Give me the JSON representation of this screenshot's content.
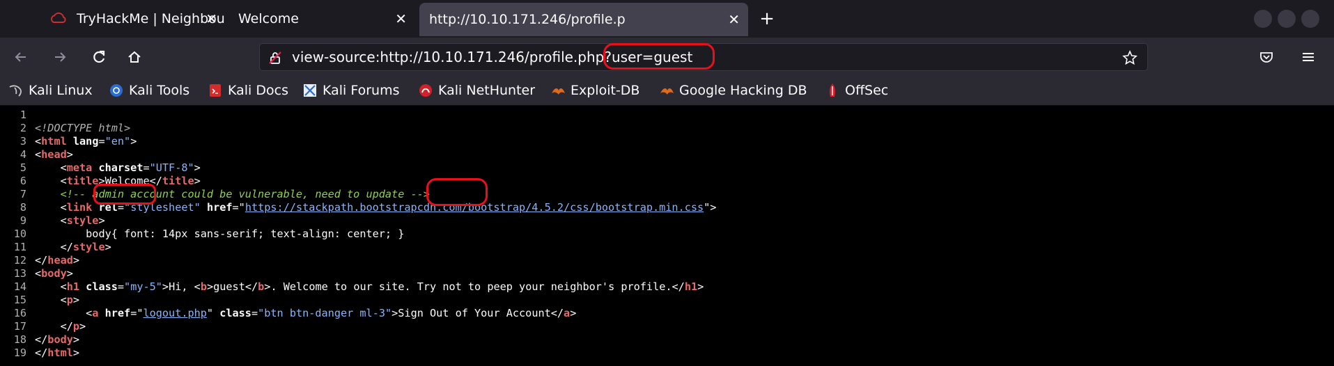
{
  "tabs": [
    {
      "label": "TryHackMe | Neighbour",
      "icon": "tryhackme-icon",
      "active": false
    },
    {
      "label": "Welcome",
      "icon": "",
      "active": false
    },
    {
      "label": "http://10.10.171.246/profile.p",
      "icon": "",
      "active": true
    }
  ],
  "nav": {
    "url_prefix": "view-source:http://10.10.171.246/profile.php",
    "url_query": "?user=guest"
  },
  "bookmarks": [
    {
      "label": "Kali Linux",
      "icon": "kali-dragon-icon"
    },
    {
      "label": "Kali Tools",
      "icon": "kali-tools-icon"
    },
    {
      "label": "Kali Docs",
      "icon": "kali-docs-icon"
    },
    {
      "label": "Kali Forums",
      "icon": "kali-forums-icon"
    },
    {
      "label": "Kali NetHunter",
      "icon": "nethunter-icon"
    },
    {
      "label": "Exploit-DB",
      "icon": "exploit-db-icon"
    },
    {
      "label": "Google Hacking DB",
      "icon": "ghdb-icon"
    },
    {
      "label": "OffSec",
      "icon": "offsec-icon"
    }
  ],
  "source": {
    "line_numbers": [
      "1",
      "2",
      "3",
      "4",
      "5",
      "6",
      "7",
      "8",
      "9",
      "10",
      "11",
      "12",
      "13",
      "14",
      "15",
      "16",
      "17",
      "18",
      "19"
    ],
    "doctype": "<!DOCTYPE html>",
    "html_tag": "html",
    "lang_attr": "lang",
    "lang_val": "\"en\"",
    "head_tag": "head",
    "meta_tag": "meta",
    "charset_attr": "charset",
    "charset_val": "\"UTF-8\"",
    "title_tag": "title",
    "title_text": "Welcome",
    "title_close": "title",
    "comment": "<!-- admin account could be vulnerable, need to update -->",
    "link_tag": "link",
    "rel_attr": "rel",
    "rel_val": "\"stylesheet\"",
    "href_attr": "href",
    "css_href": "https://stackpath.bootstrapcdn.com/bootstrap/4.5.2/css/bootstrap.min.css",
    "style_tag": "style",
    "style_body": "body{ font: 14px sans-serif; text-align: center; }",
    "style_close": "style",
    "head_close": "head",
    "body_tag": "body",
    "h1_tag": "h1",
    "class_attr": "class",
    "h1_class": "\"my-5\"",
    "h1_text_1": "Hi, ",
    "b_tag": "b",
    "b_text": "guest",
    "b_close": "b",
    "h1_text_2": ". Welcome to our site. Try not to peep your neighbor's profile.",
    "h1_close": "h1",
    "p_tag": "p",
    "a_tag": "a",
    "logout_href": "logout.php",
    "a_class": "\"btn btn-danger ml-3\"",
    "a_text": "Sign Out of Your Account",
    "a_close": "a",
    "p_close": "p",
    "body_close": "body",
    "html_close": "html"
  },
  "colors": {
    "annotation": "#e8101b",
    "tag": "#e66a6a",
    "comment": "#8fd14f",
    "attr_value": "#89b4fa"
  }
}
